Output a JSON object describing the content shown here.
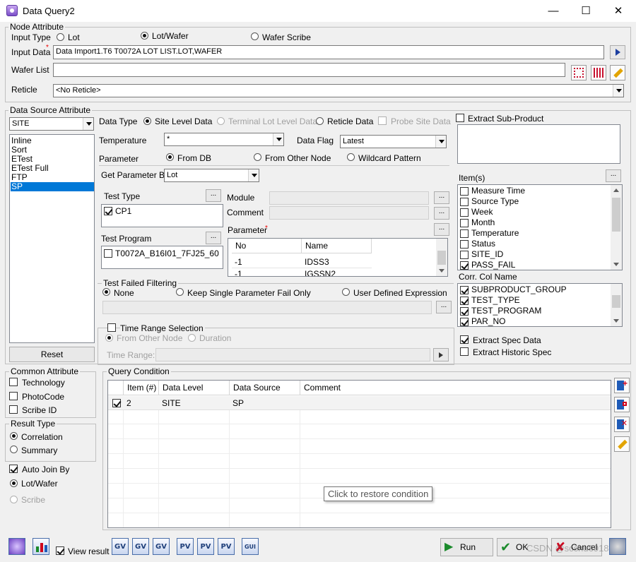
{
  "window": {
    "title": "Data Query2",
    "minimize": "—",
    "maximize": "☐",
    "close": "✕"
  },
  "node_attribute": {
    "label": "Node Attribute",
    "input_type_label": "Input Type",
    "input_types": [
      {
        "label": "Lot",
        "selected": false
      },
      {
        "label": "Lot/Wafer",
        "selected": true
      },
      {
        "label": "Wafer Scribe",
        "selected": false
      }
    ],
    "input_data_label": "Input Data",
    "required_mark": "*",
    "input_data_value": "Data Import1.T6 T0072A LOT LIST.LOT,WAFER",
    "wafer_list_label": "Wafer List",
    "wafer_list_value": "",
    "reticle_label": "Reticle",
    "reticle_value": "<No Reticle>"
  },
  "data_source": {
    "label": "Data Source Attribute",
    "source_combo": "SITE",
    "source_list": [
      "Inline",
      "Sort",
      "ETest",
      "ETest Full",
      "FTP",
      "SP"
    ],
    "source_selected": "SP",
    "reset_label": "Reset",
    "data_type_label": "Data Type",
    "data_types": [
      {
        "label": "Site Level Data",
        "selected": true,
        "enabled": true
      },
      {
        "label": "Terminal Lot Level Data",
        "selected": false,
        "enabled": false
      },
      {
        "label": "Reticle Data",
        "selected": false,
        "enabled": true
      }
    ],
    "probe_site_label": "Probe Site Data",
    "temperature_label": "Temperature",
    "temperature_value": "*",
    "data_flag_label": "Data Flag",
    "data_flag_value": "Latest",
    "parameter_label": "Parameter",
    "parameter_modes": [
      {
        "label": "From DB",
        "selected": true
      },
      {
        "label": "From Other Node",
        "selected": false
      },
      {
        "label": "Wildcard Pattern",
        "selected": false
      }
    ],
    "get_param_label": "Get Parameter By",
    "get_param_value": "Lot",
    "test_type_label": "Test Type",
    "test_type_items": [
      {
        "label": "CP1",
        "checked": true
      }
    ],
    "test_program_label": "Test Program",
    "test_program_items": [
      {
        "label": "T0072A_B16I01_7FJ25_60",
        "checked": false
      }
    ],
    "module_label": "Module",
    "comment_label": "Comment",
    "param_grid_label": "Parameter",
    "param_columns": [
      "No",
      "Name"
    ],
    "param_rows": [
      {
        "no": "-1",
        "name": "IDSS3"
      },
      {
        "no": "-1",
        "name": "IGSSN2"
      }
    ],
    "tff_label": "Test Failed Filtering",
    "tff_options": [
      {
        "label": "None",
        "selected": true
      },
      {
        "label": "Keep Single Parameter Fail Only",
        "selected": false
      },
      {
        "label": "User Defined Expression",
        "selected": false
      }
    ],
    "time_range_label": "Time Range Selection",
    "time_range_modes": [
      "From Other Node",
      "Duration"
    ],
    "time_range_field_label": "Time Range:",
    "dots": "...",
    "extract_sub_product": "Extract Sub-Product",
    "items_label": "Item(s)",
    "items": [
      {
        "label": "Measure Time",
        "checked": false
      },
      {
        "label": "Source Type",
        "checked": false
      },
      {
        "label": "Week",
        "checked": false
      },
      {
        "label": "Month",
        "checked": false
      },
      {
        "label": "Temperature",
        "checked": false
      },
      {
        "label": "Status",
        "checked": false
      },
      {
        "label": "SITE_ID",
        "checked": false
      },
      {
        "label": "PASS_FAIL",
        "checked": true
      }
    ],
    "corr_col_label": "Corr. Col Name",
    "corr_cols": [
      {
        "label": "SUBPRODUCT_GROUP",
        "checked": true
      },
      {
        "label": "TEST_TYPE",
        "checked": true
      },
      {
        "label": "TEST_PROGRAM",
        "checked": true
      },
      {
        "label": "PAR_NO",
        "checked": true
      }
    ],
    "extract_spec": {
      "label": "Extract Spec Data",
      "checked": true
    },
    "extract_hist": {
      "label": "Extract Historic Spec",
      "checked": false
    }
  },
  "common_attribute": {
    "label": "Common Attribute",
    "items": [
      "Technology",
      "PhotoCode",
      "Scribe ID"
    ]
  },
  "result_type": {
    "label": "Result Type",
    "options": [
      {
        "label": "Correlation",
        "selected": true
      },
      {
        "label": "Summary",
        "selected": false
      }
    ]
  },
  "auto_join": {
    "label": "Auto Join By",
    "checked": true,
    "options": [
      {
        "label": "Lot/Wafer",
        "selected": true,
        "enabled": true
      },
      {
        "label": "Scribe",
        "selected": false,
        "enabled": false
      }
    ]
  },
  "query_condition": {
    "label": "Query Condition",
    "columns": [
      "Item (#)",
      "Data Level",
      "Data Source",
      "Comment"
    ],
    "rows": [
      {
        "item": "2",
        "level": "SITE",
        "source": "SP",
        "comment": ""
      }
    ],
    "tooltip": "Click to restore condition"
  },
  "bottom": {
    "view_result": "View result",
    "tool_icons": [
      "GV",
      "GV",
      "GV",
      "PV",
      "PV",
      "PV",
      "GUI"
    ],
    "run": "Run",
    "ok": "OK",
    "cancel": "Cancel",
    "watermark": "CSDN @scchu6918"
  },
  "colors": {
    "selection": "#0078d7",
    "window_bg": "#f0f0f0"
  }
}
